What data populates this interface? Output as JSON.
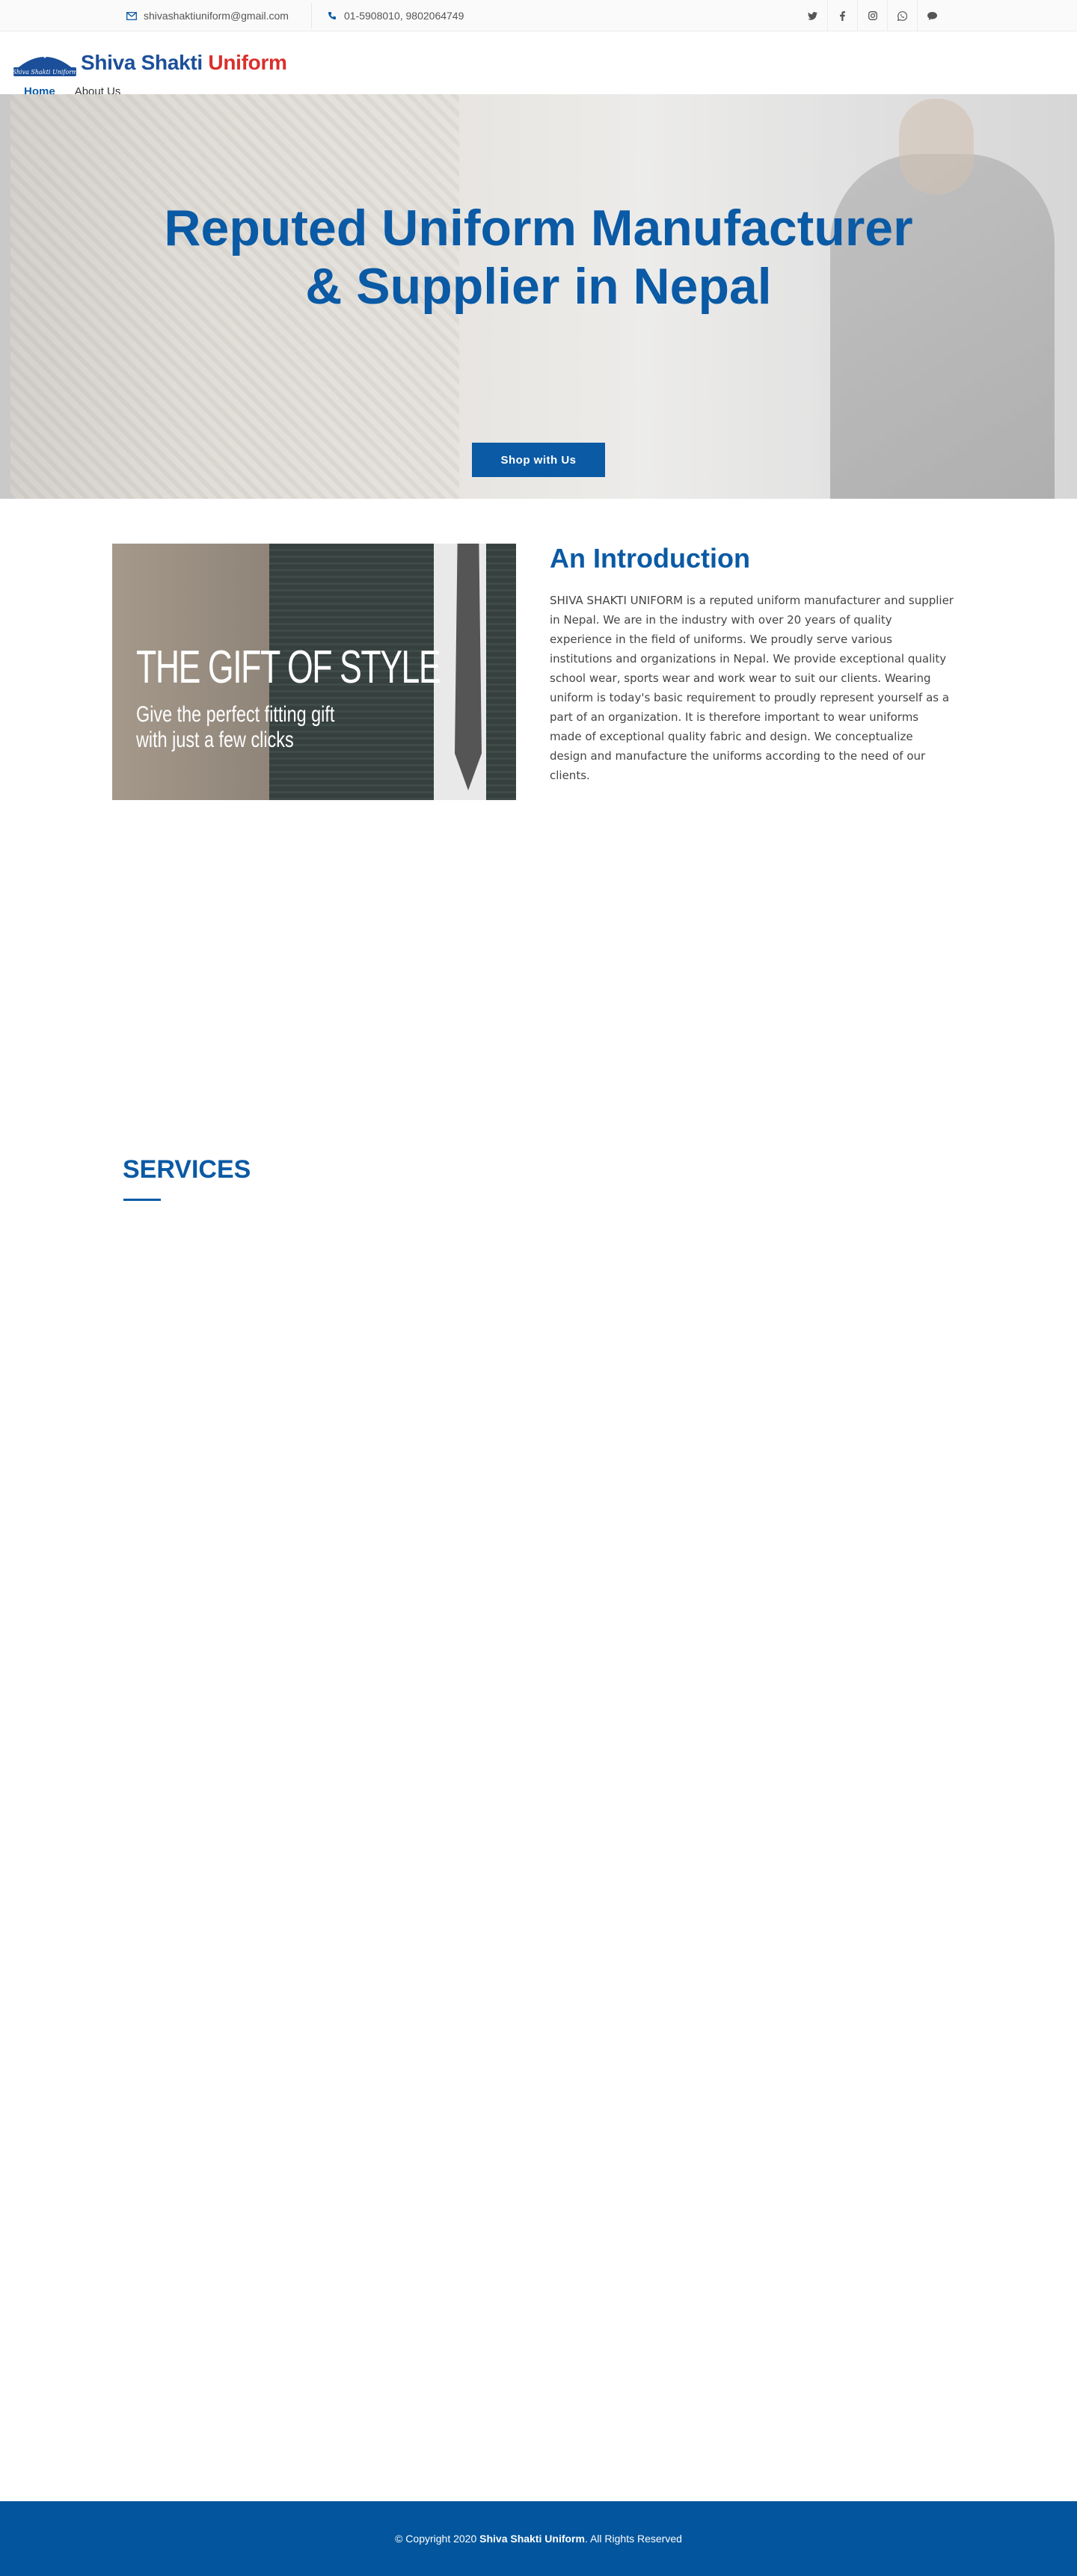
{
  "topbar": {
    "email": "shivashaktiuniform@gmail.com",
    "phone": "01-5908010, 9802064749",
    "socials": [
      {
        "name": "twitter-icon",
        "glyph": "🐦"
      },
      {
        "name": "facebook-icon",
        "glyph": "f"
      },
      {
        "name": "instagram-icon",
        "glyph": "◎"
      },
      {
        "name": "whatsapp-icon",
        "glyph": "✆"
      },
      {
        "name": "chat-icon",
        "glyph": "💬"
      }
    ]
  },
  "header": {
    "logo_part1": "Shiva Shakti",
    "logo_part2": "Uniform",
    "logo_badge": "Shiva Shakti Uniform",
    "nav": [
      {
        "label": "Home",
        "active": true
      },
      {
        "label": "About Us",
        "active": false
      }
    ]
  },
  "hero": {
    "title_line1": "Reputed Uniform Manufacturer",
    "title_line2": "& Supplier in Nepal",
    "button_label": "Shop with Us"
  },
  "intro": {
    "image_title": "THE GIFT OF STYLE",
    "image_sub1": "Give the perfect fitting gift",
    "image_sub2": "with just a few clicks",
    "heading": "An Introduction",
    "text": "SHIVA SHAKTI UNIFORM is a reputed uniform manufacturer and supplier in Nepal. We are in the industry with over 20 years of quality experience in the field of uniforms. We proudly serve various institutions and organizations in Nepal. We provide exceptional quality school wear, sports wear and work wear to suit our clients. Wearing uniform is today's basic requirement to proudly represent yourself as a part of an organization. It is therefore important to wear uniforms made of exceptional quality fabric and design. We conceptualize design and manufacture the uniforms according to the need of our clients."
  },
  "services": {
    "title": "SERVICES"
  },
  "footer": {
    "prefix": "© Copyright 2020 ",
    "brand": "Shiva Shakti Uniform",
    "suffix": ". All Rights Reserved"
  },
  "colors": {
    "accent": "#0a5aa5",
    "logo_red": "#d9302c",
    "footer_bg": "#03569d"
  }
}
